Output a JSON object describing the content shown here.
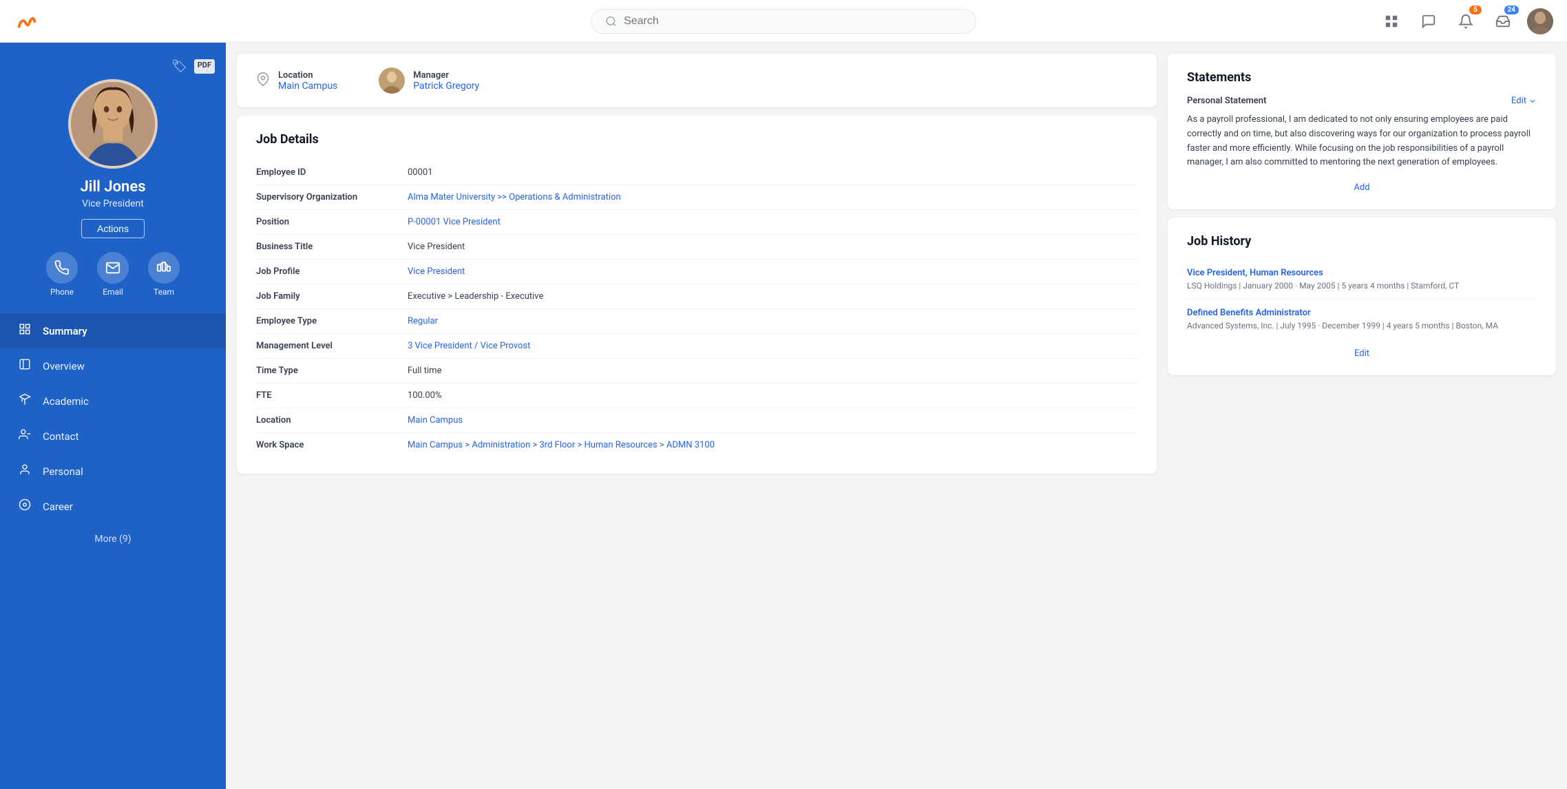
{
  "app": {
    "logo_alt": "Workday"
  },
  "topnav": {
    "search_placeholder": "Search",
    "bell_badge": "5",
    "inbox_badge": "24"
  },
  "sidebar": {
    "name": "Jill Jones",
    "title": "Vice President",
    "actions_label": "Actions",
    "icons": [
      {
        "id": "phone",
        "label": "Phone"
      },
      {
        "id": "email",
        "label": "Email"
      },
      {
        "id": "team",
        "label": "Team"
      }
    ],
    "nav_items": [
      {
        "id": "summary",
        "label": "Summary",
        "active": true
      },
      {
        "id": "overview",
        "label": "Overview"
      },
      {
        "id": "academic",
        "label": "Academic"
      },
      {
        "id": "contact",
        "label": "Contact"
      },
      {
        "id": "personal",
        "label": "Personal"
      },
      {
        "id": "career",
        "label": "Career"
      }
    ],
    "more_label": "More (9)"
  },
  "location_bar": {
    "location_label": "Location",
    "location_value": "Main Campus",
    "manager_label": "Manager",
    "manager_value": "Patrick Gregory"
  },
  "job_details": {
    "title": "Job Details",
    "rows": [
      {
        "label": "Employee ID",
        "value": "00001",
        "link": false
      },
      {
        "label": "Supervisory Organization",
        "value": "Alma Mater University >> Operations & Administration",
        "link": true
      },
      {
        "label": "Position",
        "value": "P-00001 Vice President",
        "link": true
      },
      {
        "label": "Business Title",
        "value": "Vice President",
        "link": false
      },
      {
        "label": "Job Profile",
        "value": "Vice President",
        "link": true
      },
      {
        "label": "Job Family",
        "value": "Executive > Leadership - Executive",
        "link": false
      },
      {
        "label": "Employee Type",
        "value": "Regular",
        "link": true
      },
      {
        "label": "Management Level",
        "value": "3 Vice President / Vice Provost",
        "link": true
      },
      {
        "label": "Time Type",
        "value": "Full time",
        "link": false
      },
      {
        "label": "FTE",
        "value": "100.00%",
        "link": false
      },
      {
        "label": "Location",
        "value": "Main Campus",
        "link": true
      },
      {
        "label": "Work Space",
        "value": "Main Campus > Administration > 3rd Floor > Human Resources > ADMN 3100",
        "link": true
      }
    ]
  },
  "statements": {
    "title": "Statements",
    "section_label": "Personal Statement",
    "edit_label": "Edit",
    "text": "As a payroll professional, I am dedicated to not only ensuring employees are paid correctly and on time, but also discovering ways for our organization to process payroll faster and more efficiently. While focusing on the job responsibilities of a payroll manager, I am also committed to mentoring the next generation of employees.",
    "add_label": "Add"
  },
  "job_history": {
    "title": "Job History",
    "items": [
      {
        "role": "Vice President, Human Resources",
        "company": "LSQ Holdings",
        "dates": "January 2000 · May 2005 | 5 years 4 months | Stamford, CT"
      },
      {
        "role": "Defined Benefits Administrator",
        "company": "Advanced Systems, Inc.",
        "dates": "July 1995 · December 1999 | 4 years 5 months | Boston, MA"
      }
    ],
    "edit_label": "Edit"
  }
}
